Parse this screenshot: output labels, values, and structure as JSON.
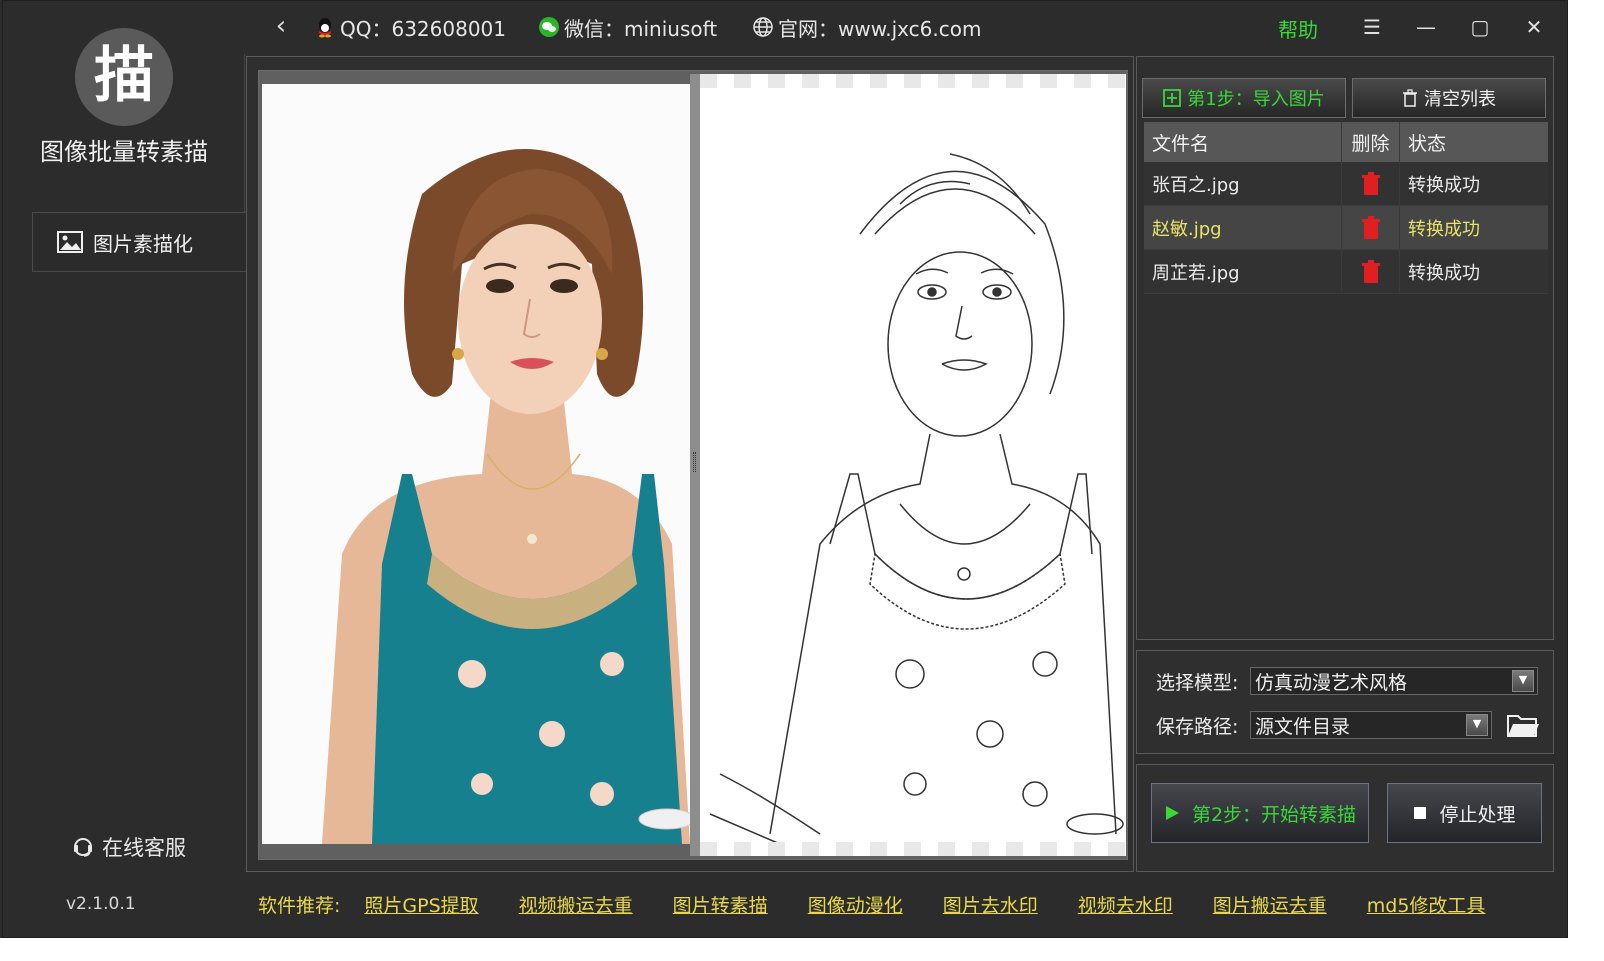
{
  "titlebar": {
    "qq_label": "QQ：632608001",
    "wechat_label": "微信：miniusoft",
    "website_label": "官网：www.jxc6.com",
    "help_label": "帮助"
  },
  "sidebar": {
    "logo_char": "描",
    "app_title": "图像批量转素描",
    "menu_item": "图片素描化",
    "service_label": "在线客服",
    "version": "v2.1.0.1"
  },
  "files": {
    "import_button": "第1步：导入图片",
    "clear_button": "清空列表",
    "headers": {
      "name": "文件名",
      "delete": "删除",
      "status": "状态"
    },
    "rows": [
      {
        "name": "张百之.jpg",
        "status": "转换成功"
      },
      {
        "name": "赵敏.jpg",
        "status": "转换成功"
      },
      {
        "name": "周芷若.jpg",
        "status": "转换成功"
      }
    ]
  },
  "settings": {
    "model_label": "选择模型:",
    "model_value": "仿真动漫艺术风格",
    "path_label": "保存路径:",
    "path_value": "源文件目录"
  },
  "actions": {
    "start_button": "第2步：开始转素描",
    "stop_button": "停止处理"
  },
  "recommend": {
    "label": "软件推荐:",
    "links": [
      "照片GPS提取",
      "视频搬运去重",
      "图片转素描",
      "图像动漫化",
      "图片去水印",
      "视频去水印",
      "图片搬运去重",
      "md5修改工具"
    ]
  },
  "colors": {
    "accent_green": "#3ad63a",
    "link_yellow": "#e8d84a",
    "delete_red": "#e02020",
    "background": "#2d2d2d"
  }
}
